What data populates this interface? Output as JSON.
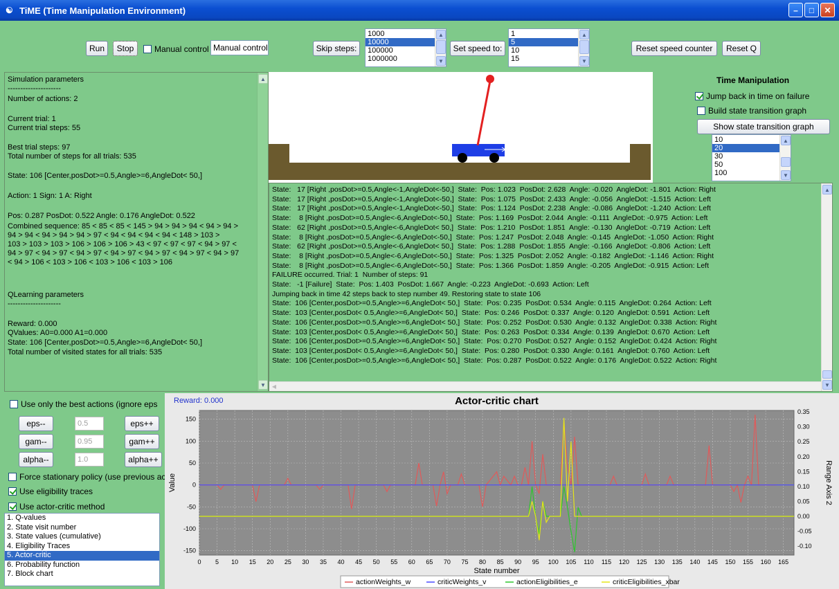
{
  "window": {
    "title": "TiME (Time Manipulation Environment)"
  },
  "toolbar": {
    "run": "Run",
    "stop": "Stop",
    "manual_control_check": "Manual control",
    "manual_control_field": "Manual control",
    "skip_steps": "Skip steps:",
    "skip_options": [
      "1000",
      "10000",
      "100000",
      "1000000"
    ],
    "skip_selected": "10000",
    "set_speed": "Set speed to:",
    "speed_options": [
      "1",
      "5",
      "10",
      "15"
    ],
    "speed_selected": "5",
    "reset_speed": "Reset speed counter",
    "reset_q": "Reset Q"
  },
  "info": {
    "sim_header": "Simulation parameters",
    "sep1": "---------------------",
    "num_actions": "Number of actions: 2",
    "current_trial": "Current trial:  1",
    "current_steps": "Current trial steps:  55",
    "best_steps": "Best trial steps:  97",
    "total_steps": "Total number of steps for all trials:  535",
    "state": "State: 106 [Center,posDot>=0.5,Angle>=6,AngleDot< 50,]",
    "action": "Action: 1   Sign: 1   A: Right",
    "pos": "Pos: 0.287  PosDot: 0.522  Angle: 0.176  AngleDot: 0.522",
    "combined": [
      "Combined sequence: 85 < 85 < 85 < 145 > 94 > 94 > 94 < 94 > 94 >",
      "94 > 94 < 94 > 94 > 94 > 97 < 94 < 94 < 94 < 94 < 148 > 103 >",
      "103 > 103 > 103 > 106 > 106 > 106 > 43 < 97 < 97 < 97 < 94 > 97 <",
      "94 > 97 < 94 > 97 < 94 > 97 < 94 > 97 < 94 > 97 < 94 > 97 < 94 > 97",
      "< 94 > 106 < 103 > 106 < 103 > 106 < 103 > 106"
    ],
    "q_header": "QLearning parameters",
    "sep2": "---------------------",
    "reward": "Reward: 0.000",
    "qvalues": "QValues:   A0=0.000  A1=0.000",
    "q_state": "State: 106 [Center,posDot>=0.5,Angle>=6,AngleDot< 50,]",
    "visited": "Total number of visited states for all trials:  535"
  },
  "time_manipulation": {
    "title": "Time Manipulation",
    "jump_back": "Jump back in time on failure",
    "build_graph": "Build state transition graph",
    "show_graph": "Show state transition graph",
    "options": [
      "10",
      "20",
      "30",
      "50",
      "100"
    ],
    "selected": "20"
  },
  "log": [
    "State:   17 [Right ,posDot>=0.5,Angle<-1,AngleDot<-50,]  State:  Pos: 1.023  PosDot: 2.628  Angle: -0.020  AngleDot: -1.801  Action: Right",
    "State:   17 [Right ,posDot>=0.5,Angle<-1,AngleDot<-50,]  State:  Pos: 1.075  PosDot: 2.433  Angle: -0.056  AngleDot: -1.515  Action: Left",
    "State:   17 [Right ,posDot>=0.5,Angle<-1,AngleDot<-50,]  State:  Pos: 1.124  PosDot: 2.238  Angle: -0.086  AngleDot: -1.240  Action: Left",
    "State:    8 [Right ,posDot>=0.5,Angle<-6,AngleDot<-50,]  State:  Pos: 1.169  PosDot: 2.044  Angle: -0.111  AngleDot: -0.975  Action: Left",
    "State:   62 [Right ,posDot>=0.5,Angle<-6,AngleDot< 50,]  State:  Pos: 1.210  PosDot: 1.851  Angle: -0.130  AngleDot: -0.719  Action: Left",
    "State:    8 [Right ,posDot>=0.5,Angle<-6,AngleDot<-50,]  State:  Pos: 1.247  PosDot: 2.048  Angle: -0.145  AngleDot: -1.050  Action: Right",
    "State:   62 [Right ,posDot>=0.5,Angle<-6,AngleDot< 50,]  State:  Pos: 1.288  PosDot: 1.855  Angle: -0.166  AngleDot: -0.806  Action: Left",
    "State:    8 [Right ,posDot>=0.5,Angle<-6,AngleDot<-50,]  State:  Pos: 1.325  PosDot: 2.052  Angle: -0.182  AngleDot: -1.146  Action: Right",
    "State:    8 [Right ,posDot>=0.5,Angle<-6,AngleDot<-50,]  State:  Pos: 1.366  PosDot: 1.859  Angle: -0.205  AngleDot: -0.915  Action: Left",
    "FAILURE occurred. Trial: 1  Number of steps: 91",
    "State:   -1 [Failure]  State:  Pos: 1.403  PosDot: 1.667  Angle: -0.223  AngleDot: -0.693  Action: Left",
    "Jumping back in time 42 steps back to step number 49. Restoring state to state 106",
    "State:  106 [Center,posDot>=0.5,Angle>=6,AngleDot< 50,]  State:  Pos: 0.235  PosDot: 0.534  Angle: 0.115  AngleDot: 0.264  Action: Left",
    "State:  103 [Center,posDot< 0.5,Angle>=6,AngleDot< 50,]  State:  Pos: 0.246  PosDot: 0.337  Angle: 0.120  AngleDot: 0.591  Action: Left",
    "State:  106 [Center,posDot>=0.5,Angle>=6,AngleDot< 50,]  State:  Pos: 0.252  PosDot: 0.530  Angle: 0.132  AngleDot: 0.338  Action: Right",
    "State:  103 [Center,posDot< 0.5,Angle>=6,AngleDot< 50,]  State:  Pos: 0.263  PosDot: 0.334  Angle: 0.139  AngleDot: 0.670  Action: Left",
    "State:  106 [Center,posDot>=0.5,Angle>=6,AngleDot< 50,]  State:  Pos: 0.270  PosDot: 0.527  Angle: 0.152  AngleDot: 0.424  Action: Right",
    "State:  103 [Center,posDot< 0.5,Angle>=6,AngleDot< 50,]  State:  Pos: 0.280  PosDot: 0.330  Angle: 0.161  AngleDot: 0.760  Action: Left",
    "State:  106 [Center,posDot>=0.5,Angle>=6,AngleDot< 50,]  State:  Pos: 0.287  PosDot: 0.522  Angle: 0.176  AngleDot: 0.522  Action: Right"
  ],
  "controls": {
    "best_actions": "Use only the best actions (ignore eps",
    "eps_minus": "eps--",
    "eps_value": "0.5",
    "eps_plus": "eps++",
    "gam_minus": "gam--",
    "gam_value": "0.95",
    "gam_plus": "gam++",
    "alpha_minus": "alpha--",
    "alpha_value": "1.0",
    "alpha_plus": "alpha++",
    "force_stationary": "Force stationary policy (use previous act",
    "use_eligibility": "Use eligibility traces",
    "use_actor_critic": "Use actor-critic method",
    "methods": [
      "1. Q-values",
      "2. State visit number",
      "3. State values (cumulative)",
      "4. Eligibility Traces",
      "5. Actor-critic",
      "6. Probability function",
      "7. Block chart"
    ],
    "selected_method": "5. Actor-critic"
  },
  "colors": {
    "panel_green": "#7fc98a",
    "selected_blue": "#316ac5",
    "pole_red": "#e32020",
    "cart_blue": "#1e3ee6",
    "track_brown": "#6b5a2e"
  },
  "chart_data": {
    "type": "line",
    "title": "Actor-critic chart",
    "reward_label": "Reward: 0.000",
    "xlabel": "State number",
    "ylabel": "Value",
    "y2label": "Range Axis 2",
    "xlim": [
      0,
      168
    ],
    "ylim": [
      -160,
      170
    ],
    "y2lim": [
      -0.13,
      0.355
    ],
    "xticks": [
      0,
      5,
      10,
      15,
      20,
      25,
      30,
      35,
      40,
      45,
      50,
      55,
      60,
      65,
      70,
      75,
      80,
      85,
      90,
      95,
      100,
      105,
      110,
      115,
      120,
      125,
      130,
      135,
      140,
      145,
      150,
      155,
      160,
      165
    ],
    "yticks": [
      150,
      100,
      50,
      0,
      -50,
      -100,
      -150
    ],
    "y2ticks": [
      "0.35",
      "0.30",
      "0.25",
      "0.20",
      "0.15",
      "0.10",
      "0.05",
      "0.00",
      "-0.05",
      "-0.10"
    ],
    "series": [
      {
        "name": "actionWeights_w",
        "color": "#e05a5a",
        "axis": "left",
        "x": [
          0,
          5,
          6,
          7,
          15,
          16,
          17,
          24,
          25,
          26,
          33,
          34,
          35,
          42,
          43,
          44,
          52,
          53,
          54,
          61,
          62,
          63,
          66,
          67,
          68,
          69,
          70,
          71,
          73,
          74,
          75,
          76,
          79,
          80,
          81,
          84,
          85,
          86,
          88,
          89,
          90,
          91,
          92,
          93,
          94,
          95,
          96,
          97,
          98,
          99,
          100,
          102,
          103,
          104,
          105,
          106,
          107,
          108,
          116,
          117,
          118,
          120,
          125,
          126,
          127,
          132,
          133,
          134,
          143,
          144,
          145,
          146,
          147,
          150,
          151,
          152,
          153,
          154,
          155,
          156,
          157,
          158,
          159,
          160,
          161,
          163
        ],
        "y": [
          0,
          0,
          -10,
          0,
          0,
          -38,
          0,
          0,
          15,
          0,
          0,
          -10,
          0,
          0,
          -55,
          0,
          0,
          -15,
          0,
          0,
          50,
          0,
          0,
          -48,
          0,
          30,
          -20,
          0,
          0,
          25,
          0,
          0,
          0,
          -50,
          0,
          30,
          0,
          20,
          0,
          20,
          0,
          0,
          40,
          0,
          100,
          0,
          -20,
          70,
          0,
          0,
          0,
          0,
          145,
          40,
          0,
          110,
          0,
          0,
          0,
          20,
          0,
          0,
          0,
          25,
          0,
          0,
          20,
          0,
          0,
          90,
          0,
          0,
          0,
          0,
          -15,
          0,
          -40,
          0,
          20,
          0,
          160,
          0,
          0,
          0,
          0,
          0
        ]
      },
      {
        "name": "criticWeights_v",
        "color": "#4a4aff",
        "axis": "left",
        "x": [
          0,
          168
        ],
        "y": [
          0,
          0
        ]
      },
      {
        "name": "actionEligibilities_e",
        "color": "#2ec62e",
        "axis": "right",
        "x": [
          0,
          92,
          93,
          94,
          95,
          96,
          97,
          98,
          99,
          100,
          101,
          102,
          103,
          104,
          105,
          106,
          107,
          108,
          109,
          110,
          168
        ],
        "y": [
          0,
          0,
          0,
          0.1,
          0,
          -0.06,
          0.05,
          0,
          0,
          0,
          0,
          0,
          0.1,
          0.03,
          -0.05,
          -0.12,
          0.03,
          0,
          0,
          0,
          0
        ]
      },
      {
        "name": "criticEligibilities_xbar",
        "color": "#e6e619",
        "axis": "right",
        "x": [
          0,
          93,
          94,
          95,
          96,
          97,
          98,
          99,
          100,
          101,
          102,
          103,
          104,
          105,
          106,
          107,
          108,
          168
        ],
        "y": [
          0,
          0,
          0.05,
          0,
          -0.08,
          0.05,
          -0.02,
          0,
          0,
          0,
          0,
          0.33,
          0.05,
          0.25,
          0,
          0,
          0,
          0
        ]
      }
    ],
    "legend": [
      "actionWeights_w",
      "criticWeights_v",
      "actionEligibilities_e",
      "criticEligibilities_xbar"
    ]
  }
}
